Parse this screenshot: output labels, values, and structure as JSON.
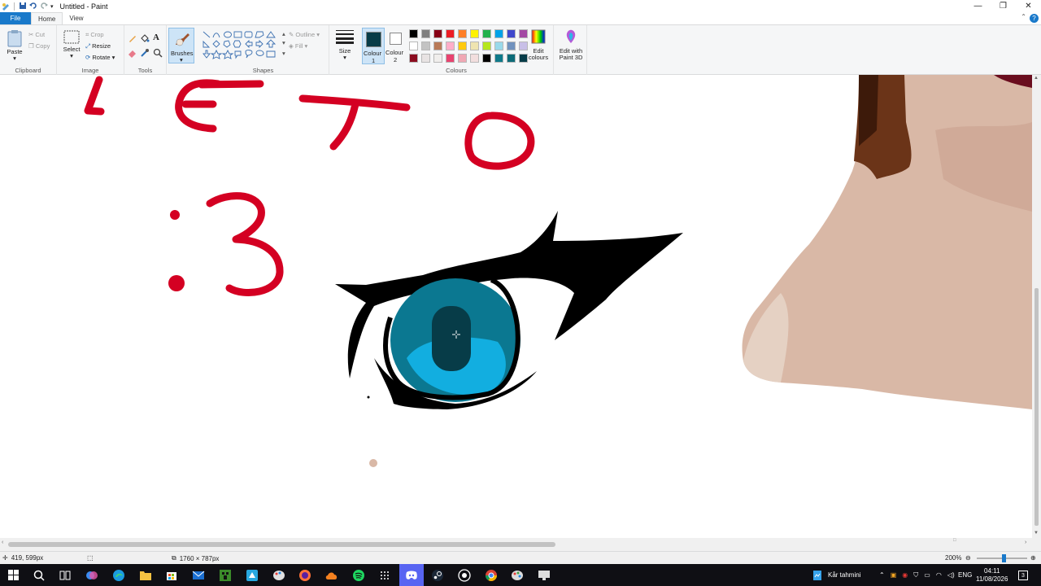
{
  "window": {
    "title": "Untitled - Paint",
    "minimize": "—",
    "maximize": "❐",
    "close": "✕"
  },
  "tabs": [
    {
      "label": "File"
    },
    {
      "label": "Home"
    },
    {
      "label": "View"
    }
  ],
  "ribbon": {
    "clipboard": {
      "paste": "Paste",
      "cut": "Cut",
      "copy": "Copy",
      "group": "Clipboard"
    },
    "image": {
      "select": "Select",
      "crop": "Crop",
      "resize": "Resize",
      "rotate": "Rotate",
      "group": "Image"
    },
    "tools": {
      "group": "Tools"
    },
    "brushes": {
      "label": "Brushes"
    },
    "shapes": {
      "outline": "Outline",
      "fill": "Fill",
      "group": "Shapes"
    },
    "size": {
      "label": "Size"
    },
    "colour1": {
      "label": "Colour",
      "num": "1",
      "color": "#073c48"
    },
    "colour2": {
      "label": "Colour",
      "num": "2",
      "color": "#ffffff"
    },
    "colours": {
      "group": "Colours",
      "edit": "Edit",
      "edit2": "colours",
      "row1": [
        "#000000",
        "#7f7f7f",
        "#880015",
        "#ed1c24",
        "#ff7f27",
        "#fff200",
        "#22b14c",
        "#00a2e8",
        "#3f48cc",
        "#a349a4"
      ],
      "row2": [
        "#ffffff",
        "#c3c3c3",
        "#b97a57",
        "#ffaec9",
        "#ffc90e",
        "#efe4b0",
        "#b5e61d",
        "#99d9ea",
        "#7092be",
        "#c8bfe7"
      ],
      "row3": [
        "#8b0c1f",
        "#e8e3e3",
        "#f0eeec",
        "#e8436f",
        "#f0a8b4",
        "#f2dede",
        "#000000",
        "#0f7a8a",
        "#0d6b78",
        "#073c48"
      ]
    },
    "paint3d": {
      "line1": "Edit with",
      "line2": "Paint 3D"
    }
  },
  "status": {
    "cursor_pos": "419, 599px",
    "canvas_size": "1760 × 787px",
    "zoom": "200%"
  },
  "taskbar": {
    "weather_text": "Kår tahmini",
    "lang": "ENG",
    "time": "04:11",
    "date": "11/08/2026",
    "notif_count": "3"
  },
  "drawing": {
    "letters": [
      "E",
      "T",
      "O",
      ":3"
    ],
    "colors": {
      "text": "#d40022",
      "lash": "#000000",
      "iris": "#0b7891",
      "iris_light": "#12aee0",
      "pupil": "#073c48",
      "skin": "#d9b8a6",
      "hair": "#6b3418"
    }
  }
}
